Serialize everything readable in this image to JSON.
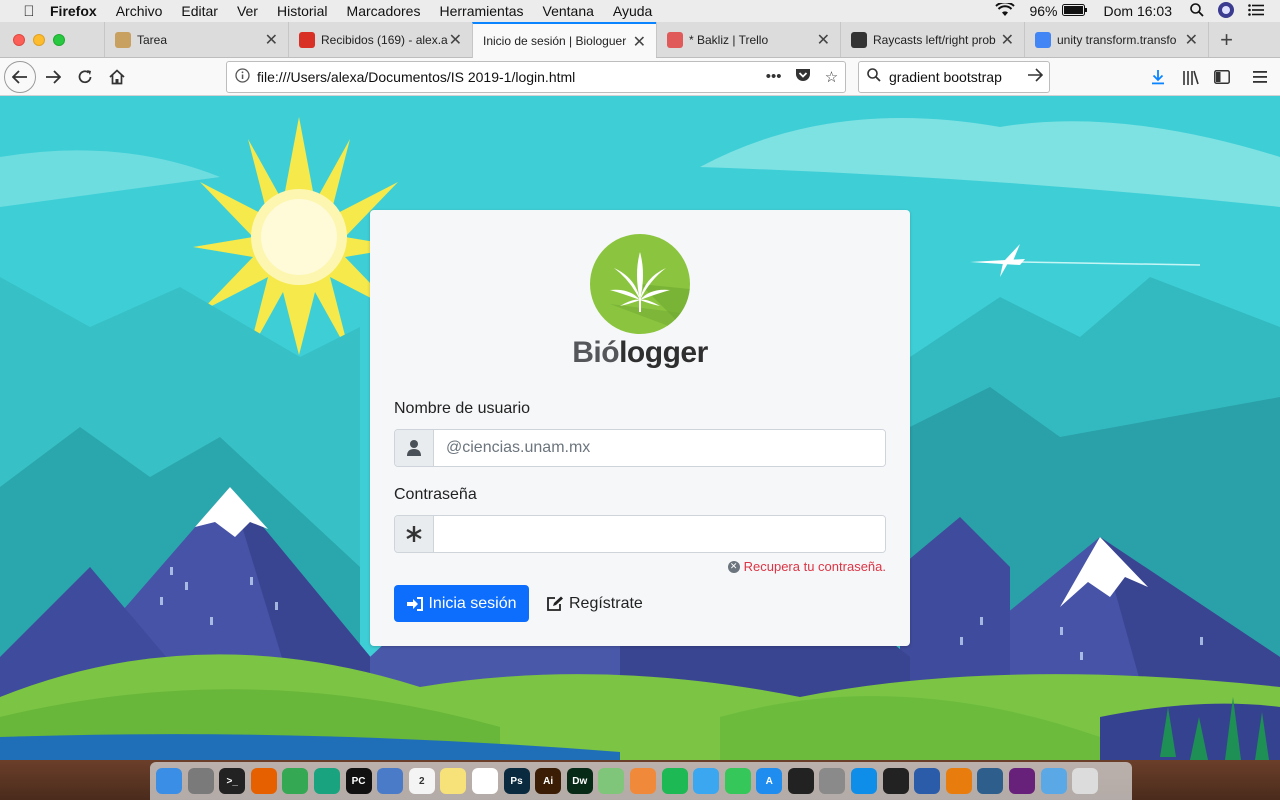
{
  "menubar": {
    "app": "Firefox",
    "items": [
      "Archivo",
      "Editar",
      "Ver",
      "Historial",
      "Marcadores",
      "Herramientas",
      "Ventana",
      "Ayuda"
    ],
    "battery": "96%",
    "clock": "Dom 16:03"
  },
  "tabs": [
    {
      "label": "Tarea",
      "favicon": "trello-icon",
      "color": "#c8a060"
    },
    {
      "label": "Recibidos (169) - alex.a",
      "favicon": "gmail-icon",
      "color": "#d93025"
    },
    {
      "label": "Inicio de sesión | Biologuer",
      "favicon": "none",
      "color": "#ffffff"
    },
    {
      "label": "* Bakliz | Trello",
      "favicon": "trello-icon",
      "color": "#e05a5a"
    },
    {
      "label": "Raycasts left/right prob",
      "favicon": "unity-icon",
      "color": "#333333"
    },
    {
      "label": "unity transform.transfo",
      "favicon": "google-icon",
      "color": "#4285f4"
    }
  ],
  "active_tab_index": 2,
  "nav": {
    "url": "file:///Users/alexa/Documentos/IS 2019-1/login.html",
    "search_value": "gradient bootstrap"
  },
  "login": {
    "brand_part1": "Bió",
    "brand_part2": "logger",
    "username_label": "Nombre de usuario",
    "username_placeholder": "@ciencias.unam.mx",
    "password_label": "Contraseña",
    "password_value": "",
    "recover_link": "Recupera tu contraseña.",
    "login_button": "Inicia sesión",
    "register_button": "Regístrate"
  },
  "colors": {
    "primary": "#0d6efd",
    "danger": "#dc3545",
    "logo_green": "#8bc53f",
    "sky": "#3ecfd6"
  },
  "dock": [
    {
      "name": "finder-icon",
      "color": "#3a8ee6",
      "text": ""
    },
    {
      "name": "launchpad-icon",
      "color": "#7a7a7a",
      "text": ""
    },
    {
      "name": "terminal-icon",
      "color": "#222222",
      "text": ">_"
    },
    {
      "name": "firefox-icon",
      "color": "#e66000",
      "text": ""
    },
    {
      "name": "chrome-icon",
      "color": "#34a853",
      "text": ""
    },
    {
      "name": "chatgpt-icon",
      "color": "#19a37f",
      "text": ""
    },
    {
      "name": "pycharm-icon",
      "color": "#111111",
      "text": "PC"
    },
    {
      "name": "preview-icon",
      "color": "#4a7bc8",
      "text": ""
    },
    {
      "name": "calendar-icon",
      "color": "#f4f4f4",
      "text": "2"
    },
    {
      "name": "notes-icon",
      "color": "#f7e27a",
      "text": ""
    },
    {
      "name": "reminders-icon",
      "color": "#ffffff",
      "text": ""
    },
    {
      "name": "photoshop-icon",
      "color": "#0a2a3f",
      "text": "Ps"
    },
    {
      "name": "illustrator-icon",
      "color": "#3a1d04",
      "text": "Ai"
    },
    {
      "name": "dreamweaver-icon",
      "color": "#072a16",
      "text": "Dw"
    },
    {
      "name": "maps-icon",
      "color": "#7fc57a",
      "text": ""
    },
    {
      "name": "photos-icon",
      "color": "#f08a3a",
      "text": ""
    },
    {
      "name": "spotify-icon",
      "color": "#1db954",
      "text": ""
    },
    {
      "name": "messages-icon",
      "color": "#3aa7f0",
      "text": ""
    },
    {
      "name": "facetime-icon",
      "color": "#35c759",
      "text": ""
    },
    {
      "name": "app-store-icon",
      "color": "#1f8cf0",
      "text": "A"
    },
    {
      "name": "activity-monitor-icon",
      "color": "#222222",
      "text": ""
    },
    {
      "name": "system-preferences-icon",
      "color": "#8a8a8a",
      "text": ""
    },
    {
      "name": "teamviewer-icon",
      "color": "#0e8ee9",
      "text": ""
    },
    {
      "name": "unity-icon",
      "color": "#222222",
      "text": ""
    },
    {
      "name": "virtualbox-icon",
      "color": "#2a5caa",
      "text": ""
    },
    {
      "name": "blender-icon",
      "color": "#e87d0d",
      "text": ""
    },
    {
      "name": "mysql-workbench-icon",
      "color": "#2d5e8c",
      "text": ""
    },
    {
      "name": "visual-studio-icon",
      "color": "#68217a",
      "text": ""
    },
    {
      "name": "downloads-icon",
      "color": "#5aa9e6",
      "text": ""
    },
    {
      "name": "trash-icon",
      "color": "#dcdcdc",
      "text": ""
    }
  ]
}
